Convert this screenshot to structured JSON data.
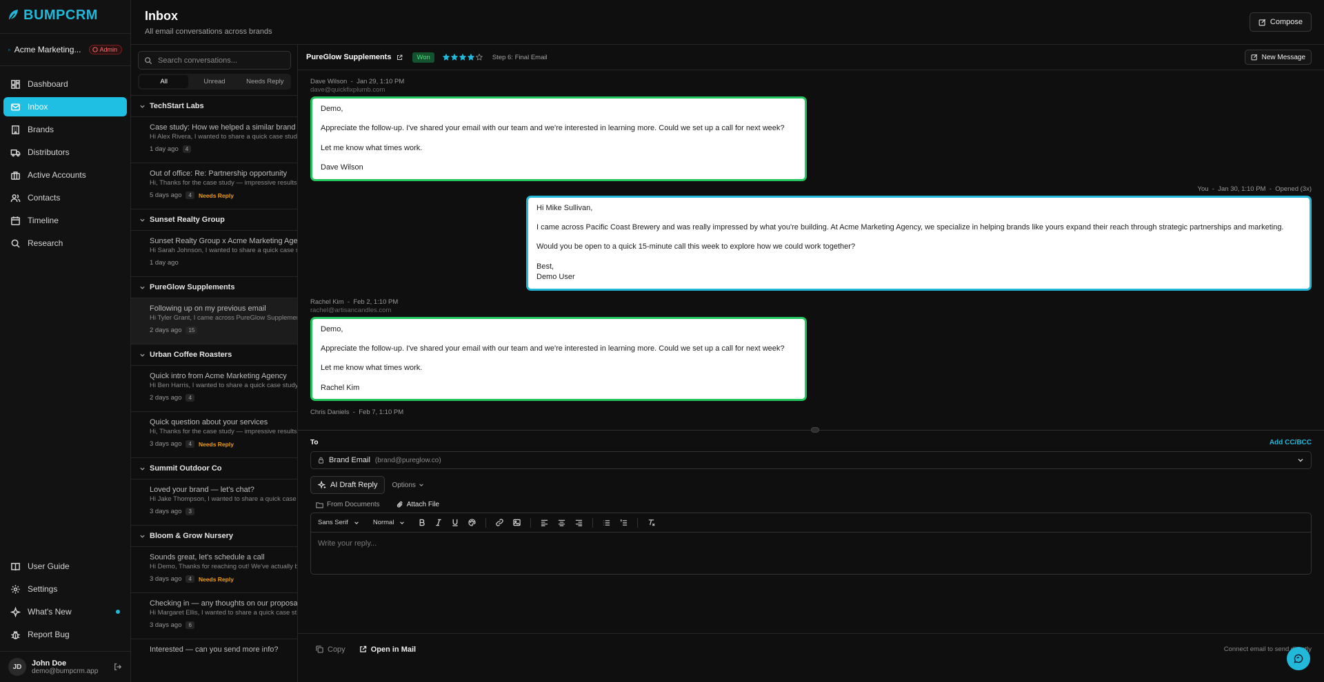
{
  "brand": {
    "name": "BUMPCRM",
    "accent": "#22b8d9"
  },
  "workspace": {
    "name": "Acme Marketing...",
    "badge": "Admin"
  },
  "nav": {
    "items": [
      {
        "label": "Dashboard",
        "icon": "dashboard-icon"
      },
      {
        "label": "Inbox",
        "icon": "mail-icon",
        "active": true
      },
      {
        "label": "Brands",
        "icon": "building-icon"
      },
      {
        "label": "Distributors",
        "icon": "truck-icon"
      },
      {
        "label": "Active Accounts",
        "icon": "briefcase-icon"
      },
      {
        "label": "Contacts",
        "icon": "users-icon"
      },
      {
        "label": "Timeline",
        "icon": "calendar-icon"
      },
      {
        "label": "Research",
        "icon": "search-icon"
      }
    ],
    "bottom": [
      {
        "label": "User Guide",
        "icon": "book-icon"
      },
      {
        "label": "Settings",
        "icon": "gear-icon"
      },
      {
        "label": "What's New",
        "icon": "sparkle-icon"
      },
      {
        "label": "Report Bug",
        "icon": "bug-icon"
      }
    ]
  },
  "user": {
    "initials": "JD",
    "name": "John Doe",
    "email": "demo@bumpcrm.app"
  },
  "header": {
    "title": "Inbox",
    "subtitle": "All email conversations across brands",
    "compose_label": "Compose"
  },
  "conversations": {
    "search_placeholder": "Search conversations...",
    "filters": [
      "All",
      "Unread",
      "Needs Reply"
    ],
    "groups": [
      {
        "name": "TechStart Labs",
        "items": [
          {
            "subject": "Case study: How we helped a similar brand",
            "preview": "Hi Alex Rivera, I wanted to share a quick case study",
            "time": "1 day ago",
            "count": "4",
            "needs_reply": ""
          },
          {
            "subject": "Out of office: Re: Partnership opportunity",
            "preview": "Hi, Thanks for the case study — impressive results",
            "time": "5 days ago",
            "count": "4",
            "needs_reply": "Needs Reply"
          }
        ]
      },
      {
        "name": "Sunset Realty Group",
        "items": [
          {
            "subject": "Sunset Realty Group x Acme Marketing Agency",
            "preview": "Hi Sarah Johnson, I wanted to share a quick case st",
            "time": "1 day ago",
            "count": "",
            "needs_reply": ""
          }
        ]
      },
      {
        "name": "PureGlow Supplements",
        "items": [
          {
            "subject": "Following up on my previous email",
            "preview": "Hi Tyler Grant, I came across PureGlow Supplements",
            "time": "2 days ago",
            "count": "15",
            "needs_reply": "",
            "selected": true
          }
        ]
      },
      {
        "name": "Urban Coffee Roasters",
        "items": [
          {
            "subject": "Quick intro from Acme Marketing Agency",
            "preview": "Hi Ben Harris, I wanted to share a quick case study",
            "time": "2 days ago",
            "count": "4",
            "needs_reply": ""
          },
          {
            "subject": "Quick question about your services",
            "preview": "Hi, Thanks for the case study — impressive results",
            "time": "3 days ago",
            "count": "4",
            "needs_reply": "Needs Reply"
          }
        ]
      },
      {
        "name": "Summit Outdoor Co",
        "items": [
          {
            "subject": "Loved your brand — let's chat?",
            "preview": "Hi Jake Thompson, I wanted to share a quick case",
            "time": "3 days ago",
            "count": "3",
            "needs_reply": ""
          }
        ]
      },
      {
        "name": "Bloom & Grow Nursery",
        "items": [
          {
            "subject": "Sounds great, let's schedule a call",
            "preview": "Hi Demo, Thanks for reaching out! We've actually b",
            "time": "3 days ago",
            "count": "4",
            "needs_reply": "Needs Reply"
          },
          {
            "subject": "Checking in — any thoughts on our proposa",
            "preview": "Hi Margaret Ellis, I wanted to share a quick case st",
            "time": "3 days ago",
            "count": "6",
            "needs_reply": ""
          },
          {
            "subject": "Interested — can you send more info?",
            "preview": "",
            "time": "",
            "count": "",
            "needs_reply": ""
          }
        ]
      }
    ]
  },
  "thread": {
    "brand": "PureGlow Supplements",
    "status": "Won",
    "rating": 4,
    "rating_max": 5,
    "step": "Step 6: Final Email",
    "new_message_label": "New Message",
    "messages": [
      {
        "direction": "in",
        "sender": "Dave Wilson",
        "date": "Jan 29, 1:10 PM",
        "email": "dave@quickfixplumb.com",
        "paragraphs": [
          "Demo,",
          "Appreciate the follow-up. I've shared your email with our team and we're interested in learning more. Could we set up a call for next week?",
          "Let me know what times work.",
          "Dave Wilson"
        ]
      },
      {
        "direction": "out",
        "sender": "You",
        "date": "Jan 30, 1:10 PM",
        "opened": "Opened (3x)",
        "paragraphs": [
          "Hi Mike Sullivan,",
          "I came across Pacific Coast Brewery and was really impressed by what you're building. At Acme Marketing Agency, we specialize in helping brands like yours expand their reach through strategic partnerships and marketing.",
          "Would you be open to a quick 15-minute call this week to explore how we could work together?",
          "Best,\nDemo User"
        ]
      },
      {
        "direction": "in",
        "sender": "Rachel Kim",
        "date": "Feb 2, 1:10 PM",
        "email": "rachel@artisancandles.com",
        "paragraphs": [
          "Demo,",
          "Appreciate the follow-up. I've shared your email with our team and we're interested in learning more. Could we set up a call for next week?",
          "Let me know what times work.",
          "Rachel Kim"
        ]
      },
      {
        "direction": "in",
        "sender": "Chris Daniels",
        "date": "Feb 7, 1:10 PM",
        "email": "",
        "paragraphs": []
      }
    ]
  },
  "composer": {
    "to_label": "To",
    "add_cc_label": "Add CC/BCC",
    "recipient_name": "Brand Email",
    "recipient_email": "(brand@pureglow.co)",
    "ai_draft_label": "AI Draft Reply",
    "options_label": "Options",
    "from_documents_label": "From Documents",
    "attach_file_label": "Attach File",
    "font_label": "Sans Serif",
    "size_label": "Normal",
    "placeholder": "Write your reply..."
  },
  "footer": {
    "copy_label": "Copy",
    "open_mail_label": "Open in Mail",
    "connect_label": "Connect email to send directly"
  }
}
